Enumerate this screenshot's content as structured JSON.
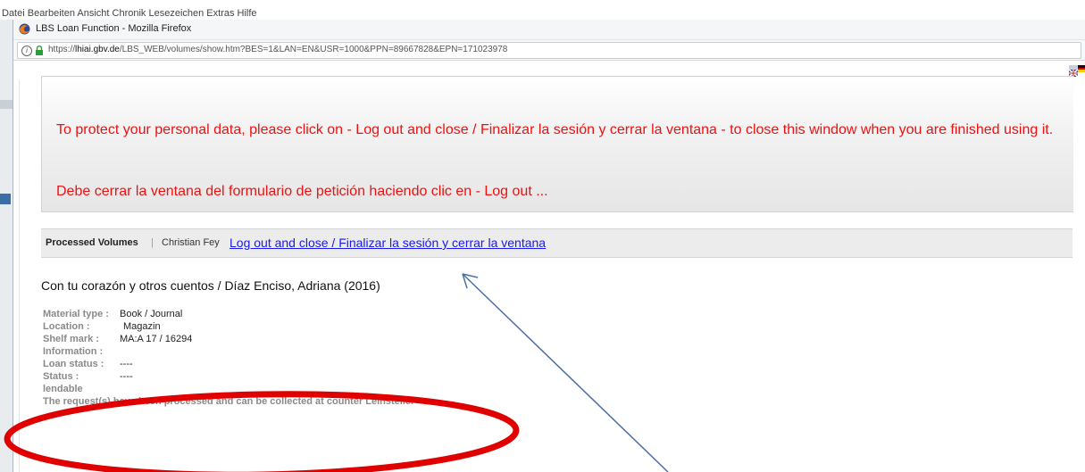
{
  "host": {
    "menu_fragment": "Datei  Bearbeiten  Ansicht  Chronik  Lesezeichen  Extras  Hilfe"
  },
  "window": {
    "title": "LBS Loan Function - Mozilla Firefox",
    "url_prefix": "https://",
    "url_domain": "lhiai.gbv.de",
    "url_path": "/LBS_WEB/volumes/show.htm?BES=1&LAN=EN&USR=1000&PPN=89667828&EPN=171023978"
  },
  "notice": {
    "line1": "To protect your personal data, please click on - Log out and close / Finalizar la sesión y cerrar la ventana - to close this window when you are finished using it.",
    "line2": "Debe cerrar la ventana del formulario de petición haciendo clic en - Log out ..."
  },
  "nav": {
    "section": "Processed Volumes",
    "separator": "|",
    "user": "Christian Fey",
    "logout": "Log out and close / Finalizar la sesión y cerrar la ventana"
  },
  "record": {
    "title": "Con tu corazón y otros cuentos / Díaz Enciso, Adriana (2016)",
    "fields": [
      {
        "label": "Material type :",
        "value": "Book / Journal"
      },
      {
        "label": "Location :",
        "value": "Magazin"
      },
      {
        "label": "Shelf mark :",
        "value": "MA:A 17 / 16294"
      },
      {
        "label": "Information :",
        "value": ""
      },
      {
        "label": "Loan status :",
        "value": "----"
      },
      {
        "label": "Status :",
        "value": "----"
      }
    ],
    "lendable": "lendable",
    "message": "The request(s) have been processed and can be collected at counter Leihstelle."
  },
  "colors": {
    "notice_text": "#ee1111",
    "link": "#1a1aee",
    "annotation_ellipse": "#e00000",
    "annotation_arrow": "#4a6fa5"
  }
}
